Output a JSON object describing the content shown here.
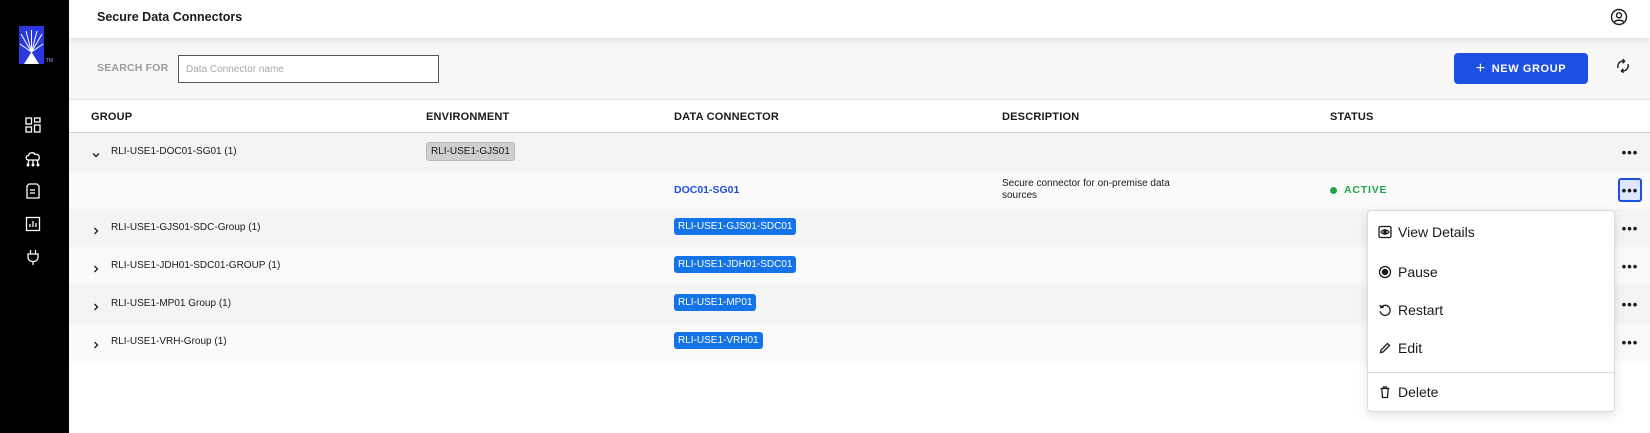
{
  "app": {
    "logo_tm": "TM"
  },
  "header": {
    "title": "Secure Data Connectors"
  },
  "toolbar": {
    "search_label": "SEARCH FOR",
    "search_placeholder": "Data Connector name",
    "search_value": "",
    "new_group_label": "NEW GROUP",
    "new_group_icon": "+"
  },
  "table": {
    "columns": [
      "GROUP",
      "ENVIRONMENT",
      "DATA CONNECTOR",
      "DESCRIPTION",
      "STATUS"
    ],
    "rows": [
      {
        "group": "RLI-USE1-DOC01-SG01 (1)",
        "expanded": true,
        "environment": "RLI-USE1-GJS01",
        "connector": "",
        "description": "",
        "status": ""
      },
      {
        "group": "",
        "environment": "",
        "connector": "DOC01-SG01",
        "description": "Secure connector for on-premise data sources",
        "status": "ACTIVE"
      },
      {
        "group": "RLI-USE1-GJS01-SDC-Group (1)",
        "expanded": false,
        "environment": "",
        "connector": "RLI-USE1-GJS01-SDC01",
        "description": "",
        "status": ""
      },
      {
        "group": "RLI-USE1-JDH01-SDC01-GROUP (1)",
        "expanded": false,
        "environment": "",
        "connector": "RLI-USE1-JDH01-SDC01",
        "description": "",
        "status": ""
      },
      {
        "group": "RLI-USE1-MP01 Group (1)",
        "expanded": false,
        "environment": "",
        "connector": "RLI-USE1-MP01",
        "description": "",
        "status": ""
      },
      {
        "group": "RLI-USE1-VRH-Group (1)",
        "expanded": false,
        "environment": "",
        "connector": "RLI-USE1-VRH01",
        "description": "",
        "status": ""
      }
    ],
    "more_label": "•••"
  },
  "menu": {
    "items": [
      {
        "label": "View Details",
        "icon": "eye-icon"
      },
      {
        "label": "Pause",
        "icon": "pause-icon"
      },
      {
        "label": "Restart",
        "icon": "restart-icon"
      },
      {
        "label": "Edit",
        "icon": "pencil-icon"
      },
      {
        "label": "Delete",
        "icon": "trash-icon"
      }
    ]
  },
  "colors": {
    "sidebar": "#000000",
    "accent": "#1e4fe3",
    "chip_blue": "#1473e6",
    "status_active": "#1fa64a"
  }
}
